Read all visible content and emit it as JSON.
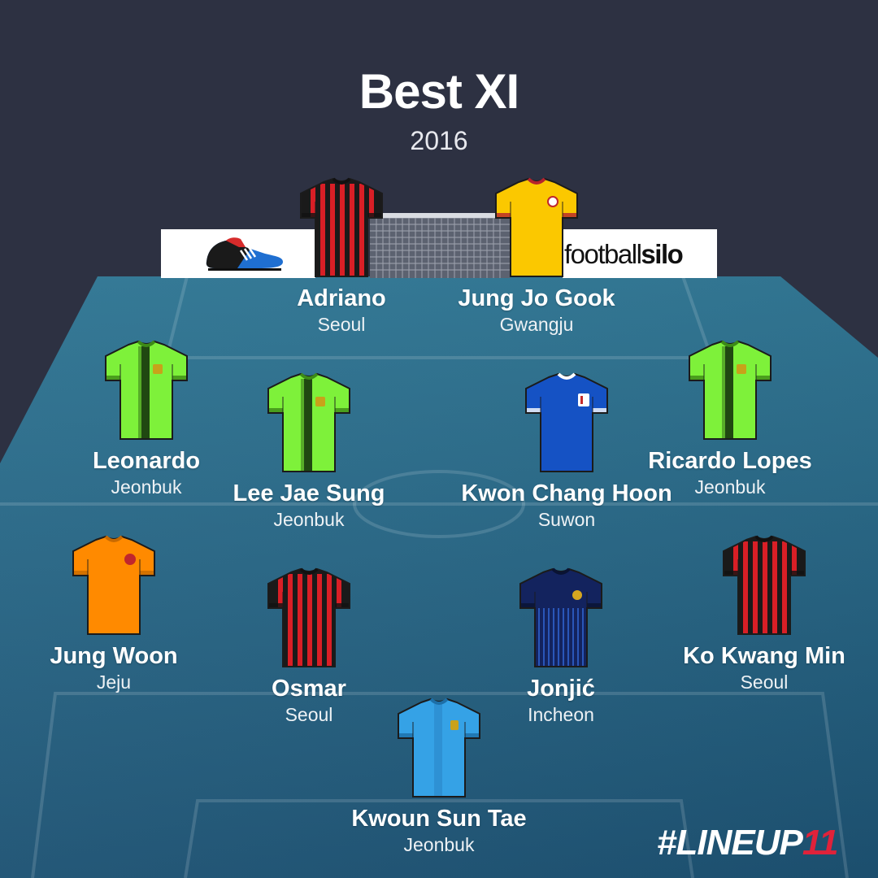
{
  "title": "Best XI",
  "year": "2016",
  "ads": {
    "right_a": "football",
    "right_b": "silo",
    "left_brand": "adidas"
  },
  "brand": {
    "text": "#LINEUP",
    "num": "11"
  },
  "kits": {
    "seoul": {
      "base": "#1a1a1a",
      "stripe": "#d91f26",
      "collar": "#111111"
    },
    "gwangju": {
      "base": "#fbc800",
      "stripe": "#fbc800",
      "collar": "#b5232d"
    },
    "jeonbuk": {
      "base": "#7ef13a",
      "stripe": "#0f2a0a",
      "collar": "#3d8a17"
    },
    "suwon": {
      "base": "#1552c4",
      "stripe": "#1552c4",
      "collar": "#ffffff"
    },
    "jeju": {
      "base": "#ff8a00",
      "stripe": "#ff8a00",
      "collar": "#c86a00"
    },
    "incheon": {
      "base": "#13235e",
      "stripe": "#2a56b8",
      "collar": "#0a1332"
    },
    "keeper": {
      "base": "#35a2e6",
      "stripe": "#2880c2",
      "collar": "#1d6fa8"
    }
  },
  "players": [
    {
      "name": "Adriano",
      "club": "Seoul",
      "kit": "seoul"
    },
    {
      "name": "Jung Jo Gook",
      "club": "Gwangju",
      "kit": "gwangju"
    },
    {
      "name": "Leonardo",
      "club": "Jeonbuk",
      "kit": "jeonbuk"
    },
    {
      "name": "Lee Jae Sung",
      "club": "Jeonbuk",
      "kit": "jeonbuk"
    },
    {
      "name": "Kwon Chang Hoon",
      "club": "Suwon",
      "kit": "suwon"
    },
    {
      "name": "Ricardo Lopes",
      "club": "Jeonbuk",
      "kit": "jeonbuk"
    },
    {
      "name": "Jung Woon",
      "club": "Jeju",
      "kit": "jeju"
    },
    {
      "name": "Osmar",
      "club": "Seoul",
      "kit": "seoul"
    },
    {
      "name": "Jonjić",
      "club": "Incheon",
      "kit": "incheon"
    },
    {
      "name": "Ko Kwang Min",
      "club": "Seoul",
      "kit": "seoul"
    },
    {
      "name": "Kwoun Sun Tae",
      "club": "Jeonbuk",
      "kit": "keeper"
    }
  ]
}
